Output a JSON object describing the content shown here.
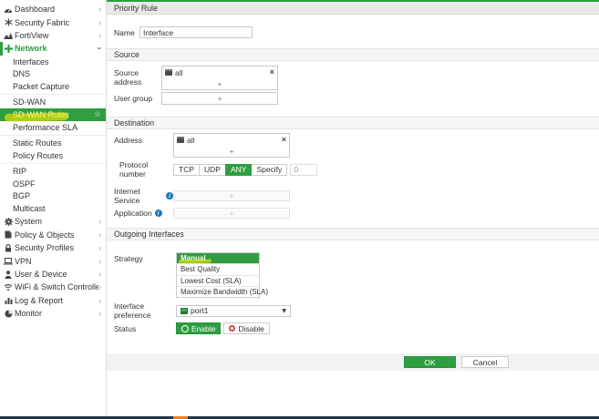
{
  "colors": {
    "accent_green": "#2e9e41",
    "footer_bar": "#253746",
    "footer_orange": "#e8821e",
    "annotation_yellow": "#ffec00",
    "info_blue": "#1879c0",
    "disable_red": "#d9534f"
  },
  "icons": {
    "chevron_right": "›",
    "chevron_down": "›",
    "dropdown_arrow": "▼",
    "star": "☆",
    "remove_x": "×",
    "add_plus": "+"
  },
  "sidebar": {
    "top_items": [
      {
        "label": "Dashboard"
      },
      {
        "label": "Security Fabric"
      },
      {
        "label": "FortiView"
      },
      {
        "label": "Network"
      }
    ],
    "network_items": [
      "Interfaces",
      "DNS",
      "Packet Capture",
      "SD-WAN",
      "SD-WAN Rules",
      "Performance SLA",
      "Static Routes",
      "Policy Routes",
      "RIP",
      "OSPF",
      "BGP",
      "Multicast"
    ],
    "active_item": "SD-WAN Rules",
    "bottom_items": [
      {
        "label": "System"
      },
      {
        "label": "Policy & Objects"
      },
      {
        "label": "Security Profiles"
      },
      {
        "label": "VPN"
      },
      {
        "label": "User & Device"
      },
      {
        "label": "WiFi & Switch Controller"
      },
      {
        "label": "Log & Report"
      },
      {
        "label": "Monitor"
      }
    ]
  },
  "form": {
    "title": "Priority Rule",
    "name": {
      "label": "Name",
      "value": "Interface"
    },
    "source": {
      "header": "Source",
      "address_label": "Source address",
      "address_value": "all",
      "user_group_label": "User group"
    },
    "destination": {
      "header": "Destination",
      "address_label": "Address",
      "address_value": "all",
      "protocol_label": "Protocol number",
      "protocol_options": [
        "TCP",
        "UDP",
        "ANY",
        "Specify"
      ],
      "protocol_selected": "ANY",
      "specify_value": "0",
      "internet_service_label": "Internet Service",
      "application_label": "Application"
    },
    "outgoing": {
      "header": "Outgoing Interfaces",
      "strategy_label": "Strategy",
      "strategy_options": [
        "Manual",
        "Best Quality",
        "Lowest Cost (SLA)",
        "Maximize Bandwidth (SLA)"
      ],
      "strategy_selected": "Manual",
      "interface_label": "Interface preference",
      "interface_value": "port1",
      "status_label": "Status",
      "enable_label": "Enable",
      "disable_label": "Disable"
    },
    "buttons": {
      "ok": "OK",
      "cancel": "Cancel"
    }
  }
}
